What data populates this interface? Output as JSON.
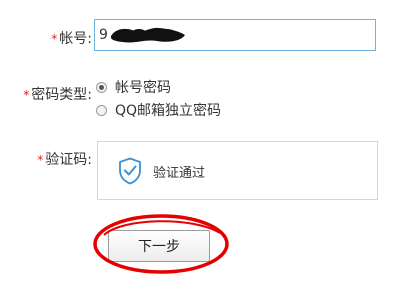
{
  "form": {
    "account": {
      "required_mark": "*",
      "label": "帐号:",
      "value": "9"
    },
    "password_type": {
      "required_mark": "*",
      "label": "密码类型:",
      "options": [
        {
          "label": "帐号密码",
          "selected": true
        },
        {
          "label": "QQ邮箱独立密码",
          "selected": false
        }
      ]
    },
    "captcha": {
      "required_mark": "*",
      "label": "验证码:",
      "status_text": "验证通过",
      "icon": "shield-check-icon"
    },
    "next_button": {
      "label": "下一步"
    }
  },
  "colors": {
    "required": "#e02020",
    "input_border_focus": "#6fb3e0",
    "shield": "#3b8fd6",
    "highlight_ring": "#e60000"
  }
}
